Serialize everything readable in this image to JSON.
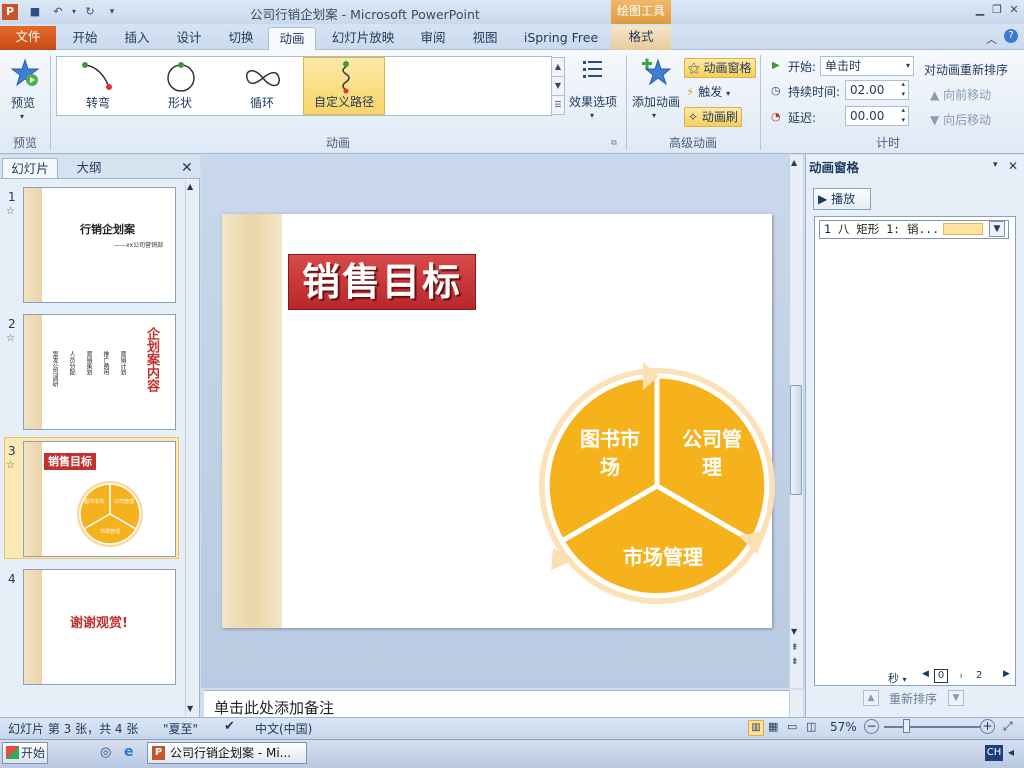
{
  "window": {
    "title": "公司行销企划案 - Microsoft PowerPoint",
    "context_tab_group": "绘图工具"
  },
  "tabs": [
    "文件",
    "开始",
    "插入",
    "设计",
    "切换",
    "动画",
    "幻灯片放映",
    "审阅",
    "视图",
    "iSpring Free",
    "格式"
  ],
  "ribbon": {
    "preview_label": "预览",
    "preview_group": "预览",
    "animations": [
      "转弯",
      "形状",
      "循环",
      "自定义路径"
    ],
    "effect_options": "效果选项",
    "animation_group": "动画",
    "add_animation": "添加动画",
    "animation_pane_btn": "动画窗格",
    "trigger_btn": "触发",
    "animation_painter_btn": "动画刷",
    "advanced_group": "高级动画",
    "start_label": "开始:",
    "start_value": "单击时",
    "duration_label": "持续时间:",
    "duration_value": "02.00",
    "delay_label": "延迟:",
    "delay_value": "00.00",
    "reorder_label": "对动画重新排序",
    "move_earlier": "向前移动",
    "move_later": "向后移动",
    "timing_group": "计时"
  },
  "left_pane": {
    "tab_slides": "幻灯片",
    "tab_outline": "大纲",
    "thumbs": [
      {
        "num": "1",
        "title": "行销企划案",
        "subtitle": "——xx公司营销部"
      },
      {
        "num": "2",
        "side_title": "企划案内容",
        "cols": [
          "案发公司调研",
          "人员分配",
          "营销策划",
          "推广费用",
          "营销计划"
        ]
      },
      {
        "num": "3",
        "title": "销售目标",
        "labels": [
          "图书市场",
          "公司管理",
          "市场管理"
        ]
      },
      {
        "num": "4",
        "title": "谢谢观赏!"
      }
    ]
  },
  "slide": {
    "title": "销售目标",
    "segments": [
      "图书市",
      "场",
      "公司管",
      "理",
      "市场管理"
    ]
  },
  "notes_placeholder": "单击此处添加备注",
  "right_pane": {
    "title": "动画窗格",
    "play": "播放",
    "item": "1 八 矩形 1: 销...",
    "seconds_label": "秒",
    "timeline_values": [
      "0",
      "2"
    ],
    "reorder_label": "重新排序"
  },
  "status": {
    "slide_info": "幻灯片 第 3 张，共 4 张",
    "theme": "\"夏至\"",
    "language": "中文(中国)",
    "zoom": "57%"
  },
  "taskbar": {
    "start": "开始",
    "ppt_task": "公司行销企划案 - Mi...",
    "ime": "CH"
  },
  "colors": {
    "accent_orange": "#f5b21c",
    "title_red": "#c2302f",
    "file_tab": "#d55a1e"
  }
}
